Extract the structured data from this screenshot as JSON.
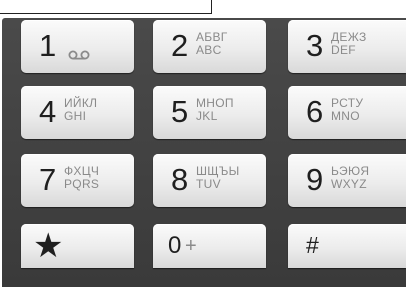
{
  "keypad": {
    "keys": [
      {
        "digit": "1",
        "icon": "voicemail-icon"
      },
      {
        "digit": "2",
        "letters_ru": "АБВГ",
        "letters_en": "ABC"
      },
      {
        "digit": "3",
        "letters_ru": "ДЕЖЗ",
        "letters_en": "DEF"
      },
      {
        "digit": "4",
        "letters_ru": "ИЙКЛ",
        "letters_en": "GHI"
      },
      {
        "digit": "5",
        "letters_ru": "МНОП",
        "letters_en": "JKL"
      },
      {
        "digit": "6",
        "letters_ru": "РСТУ",
        "letters_en": "MNO"
      },
      {
        "digit": "7",
        "letters_ru": "ФХЦЧ",
        "letters_en": "PQRS"
      },
      {
        "digit": "8",
        "letters_ru": "ШЩЪЫ",
        "letters_en": "TUV"
      },
      {
        "digit": "9",
        "letters_ru": "ЬЭЮЯ",
        "letters_en": "WXYZ"
      },
      {
        "digit": "★"
      },
      {
        "digit": "0",
        "sub": "+"
      },
      {
        "digit": "#"
      }
    ]
  },
  "colors": {
    "keypad_background": "#3f3f3f",
    "key_face": "#ececec",
    "digit_text": "#1f1f1f",
    "letters_text": "#8a8a8a"
  }
}
